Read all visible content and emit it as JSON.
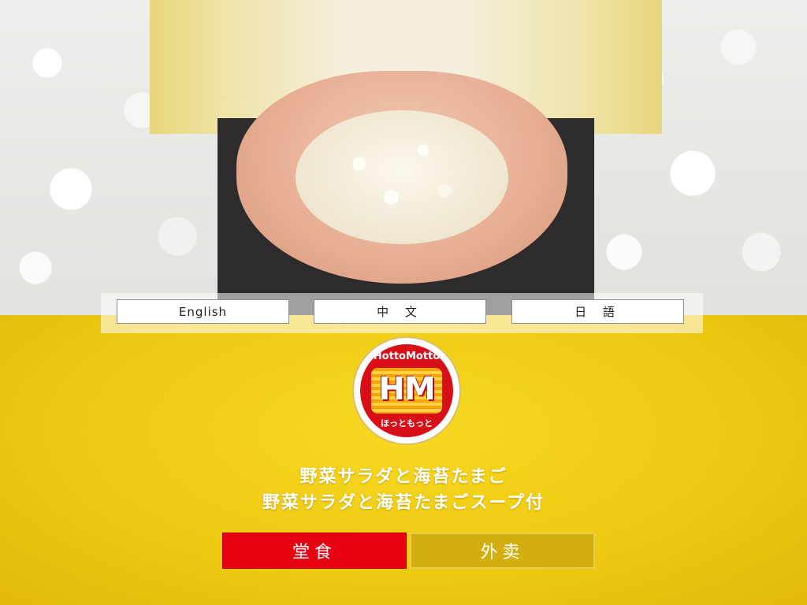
{
  "language_bar": {
    "english": "English",
    "chinese": "中 文",
    "japanese": "日 語"
  },
  "logo": {
    "arc_top": "HottoMotto",
    "monogram": "HM",
    "arc_bottom": "ほっともっと"
  },
  "product": {
    "line1": "野菜サラダと海苔たまご",
    "line2": "野菜サラダと海苔たまごスープ付"
  },
  "order_buttons": {
    "dine_in": "堂食",
    "takeout": "外卖"
  },
  "colors": {
    "background_yellow": "#efca12",
    "dine_in_red": "#e60012",
    "takeout_gold": "#d2ae10"
  }
}
